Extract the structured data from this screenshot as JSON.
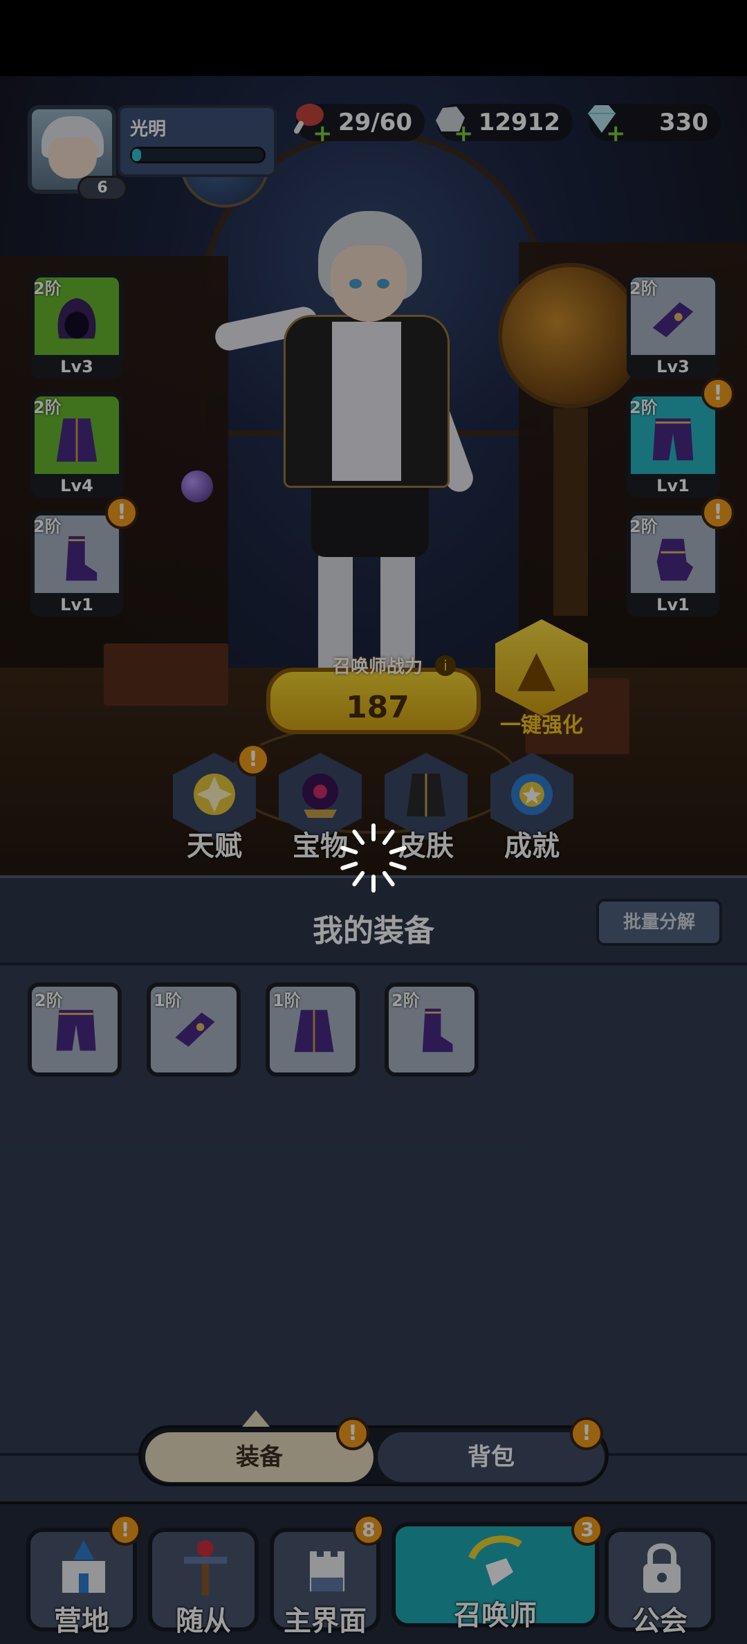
{
  "player": {
    "name": "光明",
    "level": "6",
    "exp_fraction": 0.07
  },
  "resources": {
    "stamina": {
      "value": "29/60",
      "icon": "meat-icon"
    },
    "coins": {
      "value": "12912",
      "icon": "silver-ore-icon"
    },
    "gems": {
      "value": "330",
      "icon": "diamond-icon"
    }
  },
  "equip_left": [
    {
      "tier": "2阶",
      "level": "Lv3",
      "item": "hood",
      "warn": false,
      "color": "#68b830"
    },
    {
      "tier": "2阶",
      "level": "Lv4",
      "item": "robe",
      "warn": false,
      "color": "#68b830"
    },
    {
      "tier": "2阶",
      "level": "Lv1",
      "item": "boots",
      "warn": true,
      "color": "#a8b3c4"
    }
  ],
  "equip_right": [
    {
      "tier": "2阶",
      "level": "Lv3",
      "item": "belt",
      "warn": false,
      "color": "#a8b3c4"
    },
    {
      "tier": "2阶",
      "level": "Lv1",
      "item": "pants",
      "warn": true,
      "color": "#27b7c4"
    },
    {
      "tier": "2阶",
      "level": "Lv1",
      "item": "gloves",
      "warn": true,
      "color": "#a8b3c4"
    }
  ],
  "power": {
    "label": "召唤师战力",
    "value": "187",
    "info": "i"
  },
  "upgrade_all": "一键强化",
  "features": [
    {
      "label": "天赋",
      "icon": "talent-star-icon",
      "warn": true
    },
    {
      "label": "宝物",
      "icon": "treasure-orb-icon",
      "warn": false
    },
    {
      "label": "皮肤",
      "icon": "skin-outfit-icon",
      "warn": false
    },
    {
      "label": "成就",
      "icon": "achievement-medal-icon",
      "warn": false
    }
  ],
  "panel": {
    "title": "我的装备",
    "batch_label": "批量分解"
  },
  "inventory": [
    {
      "tier": "2阶",
      "item": "pants"
    },
    {
      "tier": "1阶",
      "item": "belt"
    },
    {
      "tier": "1阶",
      "item": "robe"
    },
    {
      "tier": "2阶",
      "item": "boots"
    }
  ],
  "tabs": {
    "equip": "装备",
    "bag": "背包",
    "warn": "!"
  },
  "nav": [
    {
      "label": "营地",
      "icon": "castle-icon",
      "badge": "!"
    },
    {
      "label": "随从",
      "icon": "staff-icon",
      "badge": ""
    },
    {
      "label": "主界面",
      "icon": "fortress-icon",
      "badge": "8"
    },
    {
      "label": "召唤师",
      "icon": "summon-hand-icon",
      "badge": "3"
    },
    {
      "label": "公会",
      "icon": "lock-icon",
      "badge": ""
    }
  ],
  "colors": {
    "accent": "#f29d1c",
    "active_nav": "#1faab5",
    "panel": "#323d52",
    "gold": "#f3d533"
  }
}
